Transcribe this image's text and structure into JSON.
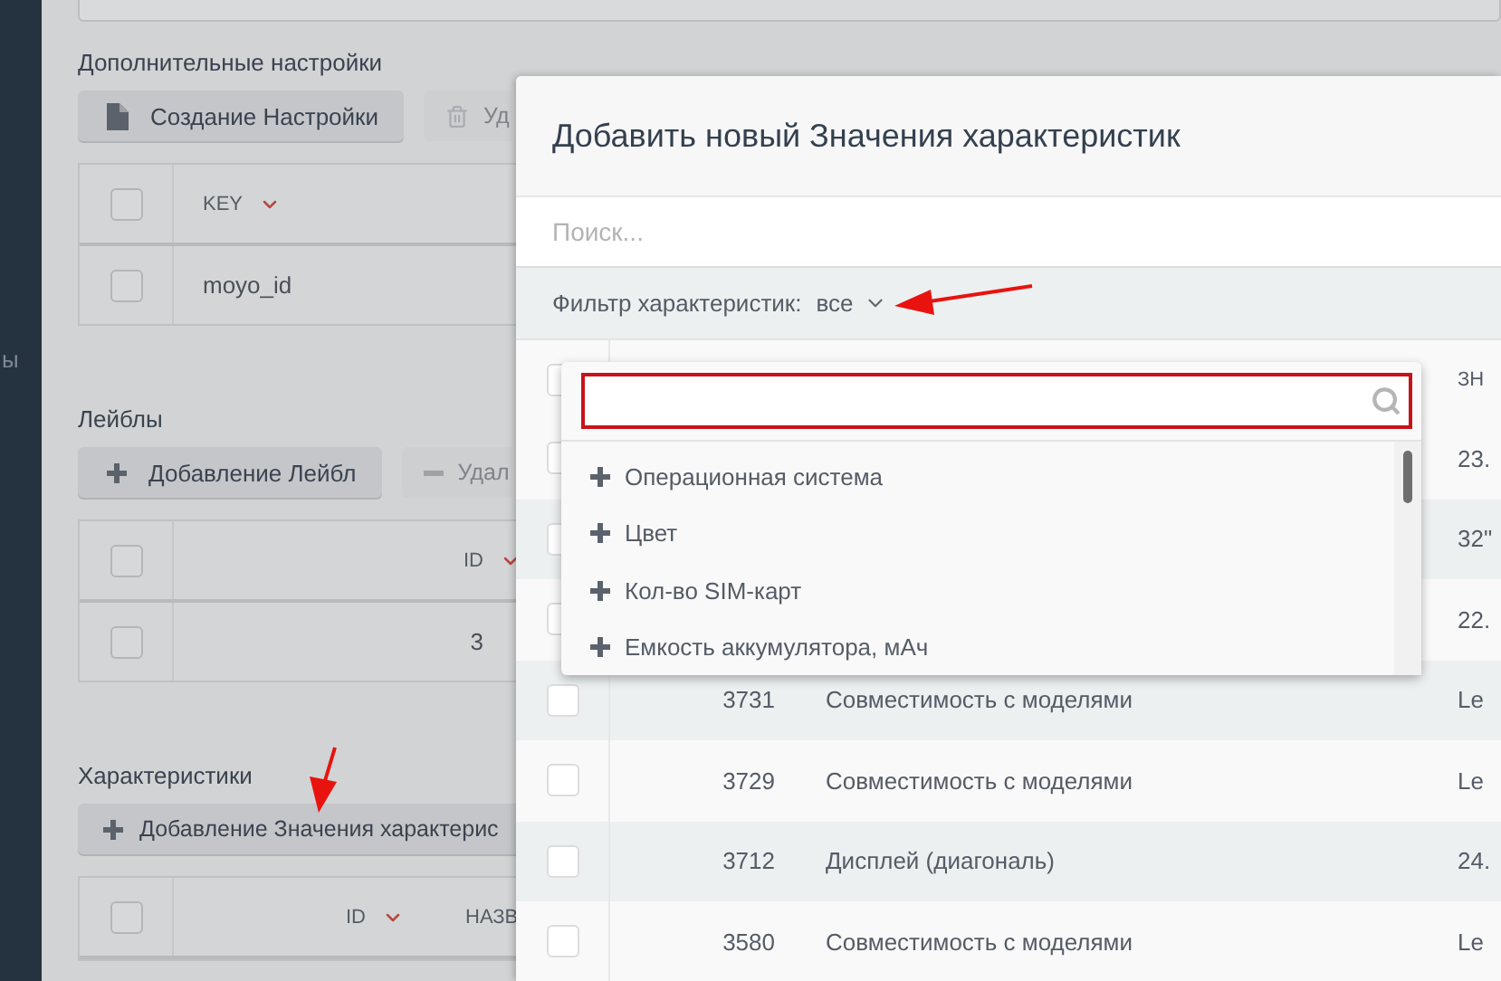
{
  "sidebar": {
    "fragment": "ы"
  },
  "sections": [
    {
      "title": "Дополнительные настройки",
      "buttons": [
        {
          "kind": "create",
          "label": "Создание Настройки",
          "disabled": false
        },
        {
          "kind": "delete",
          "label": "Уд",
          "disabled": true
        }
      ],
      "table": {
        "header_checked": false,
        "columns": [
          {
            "kind": "text",
            "label": "KEY",
            "sorted": true
          }
        ],
        "rows": [
          {
            "checked": false,
            "cells": [
              "moyo_id"
            ]
          }
        ]
      }
    },
    {
      "title": "Лейблы",
      "buttons": [
        {
          "kind": "add",
          "label": "Добавление Лейбл",
          "disabled": false
        },
        {
          "kind": "remove",
          "label": "Удал",
          "disabled": true
        }
      ],
      "table": {
        "header_checked": false,
        "columns": [
          {
            "kind": "number",
            "label": "ID",
            "sorted": true
          }
        ],
        "rows": [
          {
            "checked": false,
            "cells": [
              "3"
            ]
          }
        ]
      }
    },
    {
      "title": "Характеристики",
      "buttons": [
        {
          "kind": "add",
          "label": "Добавление Значения характерис",
          "disabled": false
        }
      ],
      "table": {
        "header_checked": false,
        "columns": [
          {
            "kind": "number",
            "label": "ID",
            "sorted": true
          },
          {
            "kind": "text",
            "label": "НАЗВ"
          }
        ]
      }
    }
  ],
  "modal": {
    "title": "Добавить новый Значения характеристик",
    "search": {
      "placeholder": "Поиск..."
    },
    "filter": {
      "label": "Фильтр характеристик:",
      "value": "все",
      "expanded": true
    },
    "dropdown": {
      "items": [
        "Операционная система",
        "Цвет",
        "Кол-во SIM-карт",
        "Емкость аккумулятора, мАч"
      ]
    },
    "table": {
      "header_checked": false,
      "columns": [
        {
          "label": "ЗН"
        }
      ],
      "rows": [
        {
          "checked": false,
          "value": "23."
        },
        {
          "checked": false,
          "value": "32\""
        },
        {
          "checked": false,
          "value": "22."
        },
        {
          "checked": false,
          "id": "3731",
          "name": "Совместимость с моделями",
          "value": "Le"
        },
        {
          "checked": false,
          "id": "3729",
          "name": "Совместимость с моделями",
          "value": "Le"
        },
        {
          "checked": false,
          "id": "3712",
          "name": "Дисплей (диагональ)",
          "value": "24."
        },
        {
          "checked": false,
          "id": "3580",
          "name": "Совместимость с моделями",
          "value": "Le"
        }
      ]
    }
  }
}
